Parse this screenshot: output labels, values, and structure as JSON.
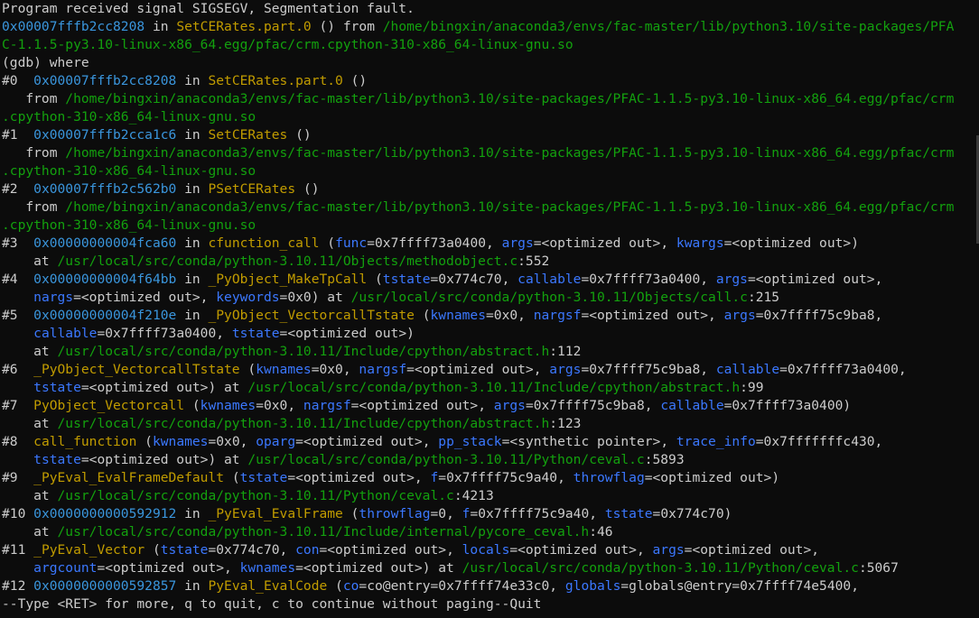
{
  "colors": {
    "background": "#0c0c0c",
    "default": "#cccccc",
    "address": "#3a96dd",
    "function": "#c19c00",
    "path": "#13a10e",
    "argument": "#3b78ff"
  },
  "lines": [
    [
      {
        "t": "Program received signal SIGSEGV, Segmentation fault.",
        "c": "default"
      }
    ],
    [
      {
        "t": "0x00007fffb2cc8208",
        "c": "addr"
      },
      {
        "t": " in ",
        "c": "default"
      },
      {
        "t": "SetCERates.part.0",
        "c": "func"
      },
      {
        "t": " () from ",
        "c": "default"
      },
      {
        "t": "/home/bingxin/anaconda3/envs/fac-master/lib/python3.10/site-packages/PFA",
        "c": "path"
      }
    ],
    [
      {
        "t": "C-1.1.5-py3.10-linux-x86_64.egg/pfac/crm.cpython-310-x86_64-linux-gnu.so",
        "c": "path"
      }
    ],
    [
      {
        "t": "(gdb) where",
        "c": "default"
      }
    ],
    [
      {
        "t": "#0  ",
        "c": "default"
      },
      {
        "t": "0x00007fffb2cc8208",
        "c": "addr"
      },
      {
        "t": " in ",
        "c": "default"
      },
      {
        "t": "SetCERates.part.0",
        "c": "func"
      },
      {
        "t": " ()",
        "c": "default"
      }
    ],
    [
      {
        "t": "   from ",
        "c": "default"
      },
      {
        "t": "/home/bingxin/anaconda3/envs/fac-master/lib/python3.10/site-packages/PFAC-1.1.5-py3.10-linux-x86_64.egg/pfac/crm",
        "c": "path"
      }
    ],
    [
      {
        "t": ".cpython-310-x86_64-linux-gnu.so",
        "c": "path"
      }
    ],
    [
      {
        "t": "#1  ",
        "c": "default"
      },
      {
        "t": "0x00007fffb2cca1c6",
        "c": "addr"
      },
      {
        "t": " in ",
        "c": "default"
      },
      {
        "t": "SetCERates",
        "c": "func"
      },
      {
        "t": " ()",
        "c": "default"
      }
    ],
    [
      {
        "t": "   from ",
        "c": "default"
      },
      {
        "t": "/home/bingxin/anaconda3/envs/fac-master/lib/python3.10/site-packages/PFAC-1.1.5-py3.10-linux-x86_64.egg/pfac/crm",
        "c": "path"
      }
    ],
    [
      {
        "t": ".cpython-310-x86_64-linux-gnu.so",
        "c": "path"
      }
    ],
    [
      {
        "t": "#2  ",
        "c": "default"
      },
      {
        "t": "0x00007fffb2c562b0",
        "c": "addr"
      },
      {
        "t": " in ",
        "c": "default"
      },
      {
        "t": "PSetCERates",
        "c": "func"
      },
      {
        "t": " ()",
        "c": "default"
      }
    ],
    [
      {
        "t": "   from ",
        "c": "default"
      },
      {
        "t": "/home/bingxin/anaconda3/envs/fac-master/lib/python3.10/site-packages/PFAC-1.1.5-py3.10-linux-x86_64.egg/pfac/crm",
        "c": "path"
      }
    ],
    [
      {
        "t": ".cpython-310-x86_64-linux-gnu.so",
        "c": "path"
      }
    ],
    [
      {
        "t": "#3  ",
        "c": "default"
      },
      {
        "t": "0x00000000004fca60",
        "c": "addr"
      },
      {
        "t": " in ",
        "c": "default"
      },
      {
        "t": "cfunction_call",
        "c": "func"
      },
      {
        "t": " (",
        "c": "default"
      },
      {
        "t": "func",
        "c": "arg"
      },
      {
        "t": "=0x7ffff73a0400, ",
        "c": "default"
      },
      {
        "t": "args",
        "c": "arg"
      },
      {
        "t": "=<optimized out>, ",
        "c": "default"
      },
      {
        "t": "kwargs",
        "c": "arg"
      },
      {
        "t": "=<optimized out>)",
        "c": "default"
      }
    ],
    [
      {
        "t": "    at ",
        "c": "default"
      },
      {
        "t": "/usr/local/src/conda/python-3.10.11/Objects/methodobject.c",
        "c": "path"
      },
      {
        "t": ":552",
        "c": "default"
      }
    ],
    [
      {
        "t": "#4  ",
        "c": "default"
      },
      {
        "t": "0x00000000004f64bb",
        "c": "addr"
      },
      {
        "t": " in ",
        "c": "default"
      },
      {
        "t": "_PyObject_MakeTpCall",
        "c": "func"
      },
      {
        "t": " (",
        "c": "default"
      },
      {
        "t": "tstate",
        "c": "arg"
      },
      {
        "t": "=0x774c70, ",
        "c": "default"
      },
      {
        "t": "callable",
        "c": "arg"
      },
      {
        "t": "=0x7ffff73a0400, ",
        "c": "default"
      },
      {
        "t": "args",
        "c": "arg"
      },
      {
        "t": "=<optimized out>,",
        "c": "default"
      }
    ],
    [
      {
        "t": "    ",
        "c": "default"
      },
      {
        "t": "nargs",
        "c": "arg"
      },
      {
        "t": "=<optimized out>, ",
        "c": "default"
      },
      {
        "t": "keywords",
        "c": "arg"
      },
      {
        "t": "=0x0) at ",
        "c": "default"
      },
      {
        "t": "/usr/local/src/conda/python-3.10.11/Objects/call.c",
        "c": "path"
      },
      {
        "t": ":215",
        "c": "default"
      }
    ],
    [
      {
        "t": "#5  ",
        "c": "default"
      },
      {
        "t": "0x00000000004f210e",
        "c": "addr"
      },
      {
        "t": " in ",
        "c": "default"
      },
      {
        "t": "_PyObject_VectorcallTstate",
        "c": "func"
      },
      {
        "t": " (",
        "c": "default"
      },
      {
        "t": "kwnames",
        "c": "arg"
      },
      {
        "t": "=0x0, ",
        "c": "default"
      },
      {
        "t": "nargsf",
        "c": "arg"
      },
      {
        "t": "=<optimized out>, ",
        "c": "default"
      },
      {
        "t": "args",
        "c": "arg"
      },
      {
        "t": "=0x7ffff75c9ba8,",
        "c": "default"
      }
    ],
    [
      {
        "t": "    ",
        "c": "default"
      },
      {
        "t": "callable",
        "c": "arg"
      },
      {
        "t": "=0x7ffff73a0400, ",
        "c": "default"
      },
      {
        "t": "tstate",
        "c": "arg"
      },
      {
        "t": "=<optimized out>)",
        "c": "default"
      }
    ],
    [
      {
        "t": "    at ",
        "c": "default"
      },
      {
        "t": "/usr/local/src/conda/python-3.10.11/Include/cpython/abstract.h",
        "c": "path"
      },
      {
        "t": ":112",
        "c": "default"
      }
    ],
    [
      {
        "t": "#6  ",
        "c": "default"
      },
      {
        "t": "_PyObject_VectorcallTstate",
        "c": "func"
      },
      {
        "t": " (",
        "c": "default"
      },
      {
        "t": "kwnames",
        "c": "arg"
      },
      {
        "t": "=0x0, ",
        "c": "default"
      },
      {
        "t": "nargsf",
        "c": "arg"
      },
      {
        "t": "=<optimized out>, ",
        "c": "default"
      },
      {
        "t": "args",
        "c": "arg"
      },
      {
        "t": "=0x7ffff75c9ba8, ",
        "c": "default"
      },
      {
        "t": "callable",
        "c": "arg"
      },
      {
        "t": "=0x7ffff73a0400,",
        "c": "default"
      }
    ],
    [
      {
        "t": "    ",
        "c": "default"
      },
      {
        "t": "tstate",
        "c": "arg"
      },
      {
        "t": "=<optimized out>) at ",
        "c": "default"
      },
      {
        "t": "/usr/local/src/conda/python-3.10.11/Include/cpython/abstract.h",
        "c": "path"
      },
      {
        "t": ":99",
        "c": "default"
      }
    ],
    [
      {
        "t": "#7  ",
        "c": "default"
      },
      {
        "t": "PyObject_Vectorcall",
        "c": "func"
      },
      {
        "t": " (",
        "c": "default"
      },
      {
        "t": "kwnames",
        "c": "arg"
      },
      {
        "t": "=0x0, ",
        "c": "default"
      },
      {
        "t": "nargsf",
        "c": "arg"
      },
      {
        "t": "=<optimized out>, ",
        "c": "default"
      },
      {
        "t": "args",
        "c": "arg"
      },
      {
        "t": "=0x7ffff75c9ba8, ",
        "c": "default"
      },
      {
        "t": "callable",
        "c": "arg"
      },
      {
        "t": "=0x7ffff73a0400)",
        "c": "default"
      }
    ],
    [
      {
        "t": "    at ",
        "c": "default"
      },
      {
        "t": "/usr/local/src/conda/python-3.10.11/Include/cpython/abstract.h",
        "c": "path"
      },
      {
        "t": ":123",
        "c": "default"
      }
    ],
    [
      {
        "t": "#8  ",
        "c": "default"
      },
      {
        "t": "call_function",
        "c": "func"
      },
      {
        "t": " (",
        "c": "default"
      },
      {
        "t": "kwnames",
        "c": "arg"
      },
      {
        "t": "=0x0, ",
        "c": "default"
      },
      {
        "t": "oparg",
        "c": "arg"
      },
      {
        "t": "=<optimized out>, ",
        "c": "default"
      },
      {
        "t": "pp_stack",
        "c": "arg"
      },
      {
        "t": "=<synthetic pointer>, ",
        "c": "default"
      },
      {
        "t": "trace_info",
        "c": "arg"
      },
      {
        "t": "=0x7fffffffc430,",
        "c": "default"
      }
    ],
    [
      {
        "t": "    ",
        "c": "default"
      },
      {
        "t": "tstate",
        "c": "arg"
      },
      {
        "t": "=<optimized out>) at ",
        "c": "default"
      },
      {
        "t": "/usr/local/src/conda/python-3.10.11/Python/ceval.c",
        "c": "path"
      },
      {
        "t": ":5893",
        "c": "default"
      }
    ],
    [
      {
        "t": "#9  ",
        "c": "default"
      },
      {
        "t": "_PyEval_EvalFrameDefault",
        "c": "func"
      },
      {
        "t": " (",
        "c": "default"
      },
      {
        "t": "tstate",
        "c": "arg"
      },
      {
        "t": "=<optimized out>, ",
        "c": "default"
      },
      {
        "t": "f",
        "c": "arg"
      },
      {
        "t": "=0x7ffff75c9a40, ",
        "c": "default"
      },
      {
        "t": "throwflag",
        "c": "arg"
      },
      {
        "t": "=<optimized out>)",
        "c": "default"
      }
    ],
    [
      {
        "t": "    at ",
        "c": "default"
      },
      {
        "t": "/usr/local/src/conda/python-3.10.11/Python/ceval.c",
        "c": "path"
      },
      {
        "t": ":4213",
        "c": "default"
      }
    ],
    [
      {
        "t": "#10 ",
        "c": "default"
      },
      {
        "t": "0x0000000000592912",
        "c": "addr"
      },
      {
        "t": " in ",
        "c": "default"
      },
      {
        "t": "_PyEval_EvalFrame",
        "c": "func"
      },
      {
        "t": " (",
        "c": "default"
      },
      {
        "t": "throwflag",
        "c": "arg"
      },
      {
        "t": "=0, ",
        "c": "default"
      },
      {
        "t": "f",
        "c": "arg"
      },
      {
        "t": "=0x7ffff75c9a40, ",
        "c": "default"
      },
      {
        "t": "tstate",
        "c": "arg"
      },
      {
        "t": "=0x774c70)",
        "c": "default"
      }
    ],
    [
      {
        "t": "    at ",
        "c": "default"
      },
      {
        "t": "/usr/local/src/conda/python-3.10.11/Include/internal/pycore_ceval.h",
        "c": "path"
      },
      {
        "t": ":46",
        "c": "default"
      }
    ],
    [
      {
        "t": "#11 ",
        "c": "default"
      },
      {
        "t": "_PyEval_Vector",
        "c": "func"
      },
      {
        "t": " (",
        "c": "default"
      },
      {
        "t": "tstate",
        "c": "arg"
      },
      {
        "t": "=0x774c70, ",
        "c": "default"
      },
      {
        "t": "con",
        "c": "arg"
      },
      {
        "t": "=<optimized out>, ",
        "c": "default"
      },
      {
        "t": "locals",
        "c": "arg"
      },
      {
        "t": "=<optimized out>, ",
        "c": "default"
      },
      {
        "t": "args",
        "c": "arg"
      },
      {
        "t": "=<optimized out>,",
        "c": "default"
      }
    ],
    [
      {
        "t": "    ",
        "c": "default"
      },
      {
        "t": "argcount",
        "c": "arg"
      },
      {
        "t": "=<optimized out>, ",
        "c": "default"
      },
      {
        "t": "kwnames",
        "c": "arg"
      },
      {
        "t": "=<optimized out>) at ",
        "c": "default"
      },
      {
        "t": "/usr/local/src/conda/python-3.10.11/Python/ceval.c",
        "c": "path"
      },
      {
        "t": ":5067",
        "c": "default"
      }
    ],
    [
      {
        "t": "#12 ",
        "c": "default"
      },
      {
        "t": "0x0000000000592857",
        "c": "addr"
      },
      {
        "t": " in ",
        "c": "default"
      },
      {
        "t": "PyEval_EvalCode",
        "c": "func"
      },
      {
        "t": " (",
        "c": "default"
      },
      {
        "t": "co",
        "c": "arg"
      },
      {
        "t": "=co@entry=0x7ffff74e33c0, ",
        "c": "default"
      },
      {
        "t": "globals",
        "c": "arg"
      },
      {
        "t": "=globals@entry=0x7ffff74e5400,",
        "c": "default"
      }
    ],
    [
      {
        "t": "--Type <RET> for more, q to quit, c to continue without paging--Quit",
        "c": "default"
      }
    ]
  ]
}
